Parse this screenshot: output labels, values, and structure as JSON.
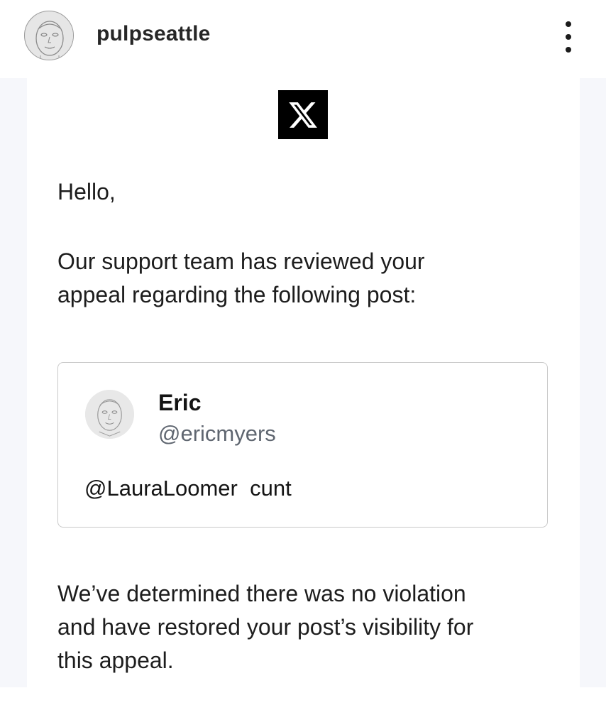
{
  "post": {
    "username": "pulpseattle",
    "avatar_icon": "user-avatar-sketch-icon",
    "more_icon": "more-vertical-icon"
  },
  "email": {
    "logo_icon": "x-logo-icon",
    "greeting": "Hello,",
    "intro_line1": "Our support team has reviewed your",
    "intro_line2": "appeal regarding the following post:",
    "tweet": {
      "name": "Eric",
      "handle": "@ericmyers",
      "mention": "@LauraLoomer",
      "text": "cunt"
    },
    "result_line1": "We’ve determined there was no violation",
    "result_line2": "and have restored your post’s visibility for",
    "result_line3": "this appeal."
  },
  "colors": {
    "background": "#ffffff",
    "email_frame": "#f6f7fb",
    "logo_bg": "#000000",
    "handle_gray": "#5f6670",
    "border": "#c9c9c9"
  }
}
